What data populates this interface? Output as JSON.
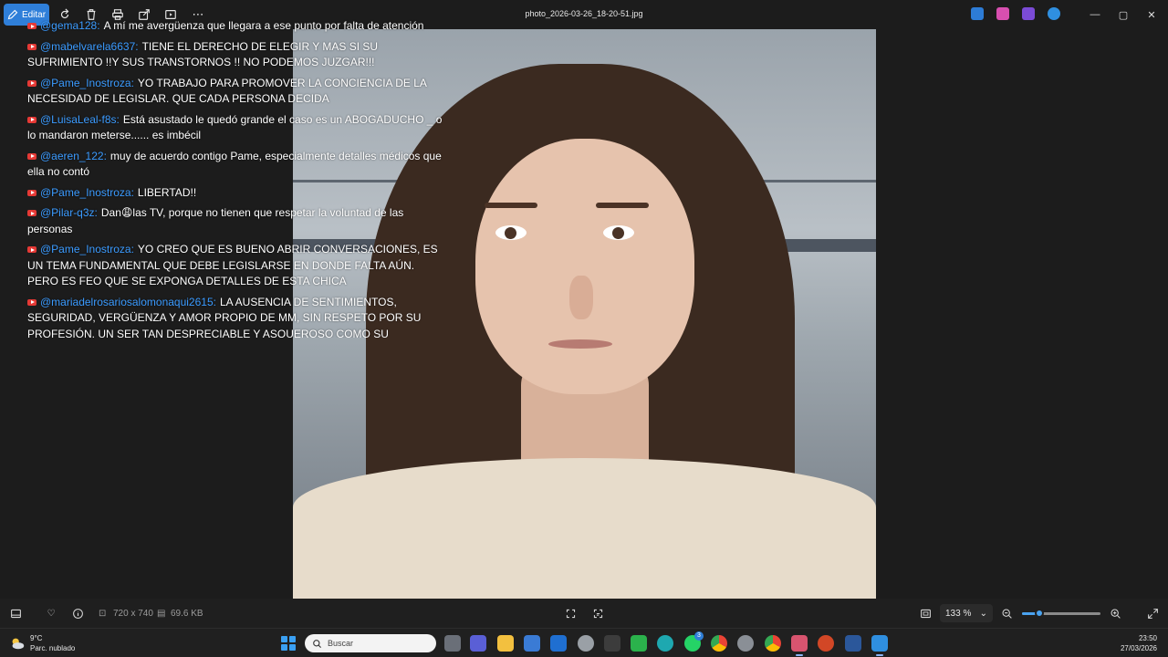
{
  "window": {
    "title": "photo_2026-03-26_18-20-51.jpg",
    "edit_label": "Editar"
  },
  "chat": [
    {
      "user": "@gema128:",
      "text": "A mí me avergüenza que llegara a ese punto por falta de atención"
    },
    {
      "user": "@mabelvarela6637:",
      "text": "TIENE EL DERECHO DE ELEGIR Y MAS SI SU SUFRIMIENTO !!Y SUS TRANSTORNOS !! NO PODEMOS JUZGAR!!!"
    },
    {
      "user": "@Pame_Inostroza:",
      "text": "YO TRABAJO PARA PROMOVER LA CONCIENCIA DE LA NECESIDAD DE LEGISLAR. QUE CADA PERSONA DECIDA"
    },
    {
      "user": "@LuisaLeal-f8s:",
      "text": "Está asustado le quedó grande el caso es un ABOGADUCHO _ o lo mandaron meterse...... es imbécil"
    },
    {
      "user": "@aeren_122:",
      "text": "muy de acuerdo contigo Pame, especialmente detalles médicos que ella no contó"
    },
    {
      "user": "@Pame_Inostroza:",
      "text": "LIBERTAD!!"
    },
    {
      "user": "@Pilar-q3z:",
      "text": "Dan😩las TV, porque no tienen que respetar la voluntad de las personas"
    },
    {
      "user": "@Pame_Inostroza:",
      "text": "YO CREO QUE ES BUENO ABRIR CONVERSACIONES, ES UN TEMA FUNDAMENTAL QUE DEBE LEGISLARSE EN DONDE FALTA AÚN. PERO ES FEO QUE SE EXPONGA DETALLES DE ESTA CHICA"
    },
    {
      "user": "@mariadelrosariosalomonaqui2615:",
      "text": "LA AUSENCIA DE SENTIMIENTOS, SEGURIDAD, VERGÜENZA Y AMOR PROPIO DE MM, SIN RESPETO POR SU PROFESIÓN, UN SER TAN DESPRECIABLE Y ASQUEROSO COMO SU DEFENDIDO"
    }
  ],
  "status": {
    "dimensions": "720 x 740",
    "filesize": "69.6 KB",
    "zoom": "133 %",
    "zoom_fraction": 0.22
  },
  "taskbar": {
    "temperature": "9°C",
    "condition": "Parc. nublado",
    "search_placeholder": "Buscar",
    "time": "23:50",
    "date": "27/03/2026",
    "whatsapp_badge": "3"
  },
  "colors": {
    "accent": "#2f7fd9",
    "chat_user": "#3b9bff",
    "youtube": "#e53935"
  }
}
